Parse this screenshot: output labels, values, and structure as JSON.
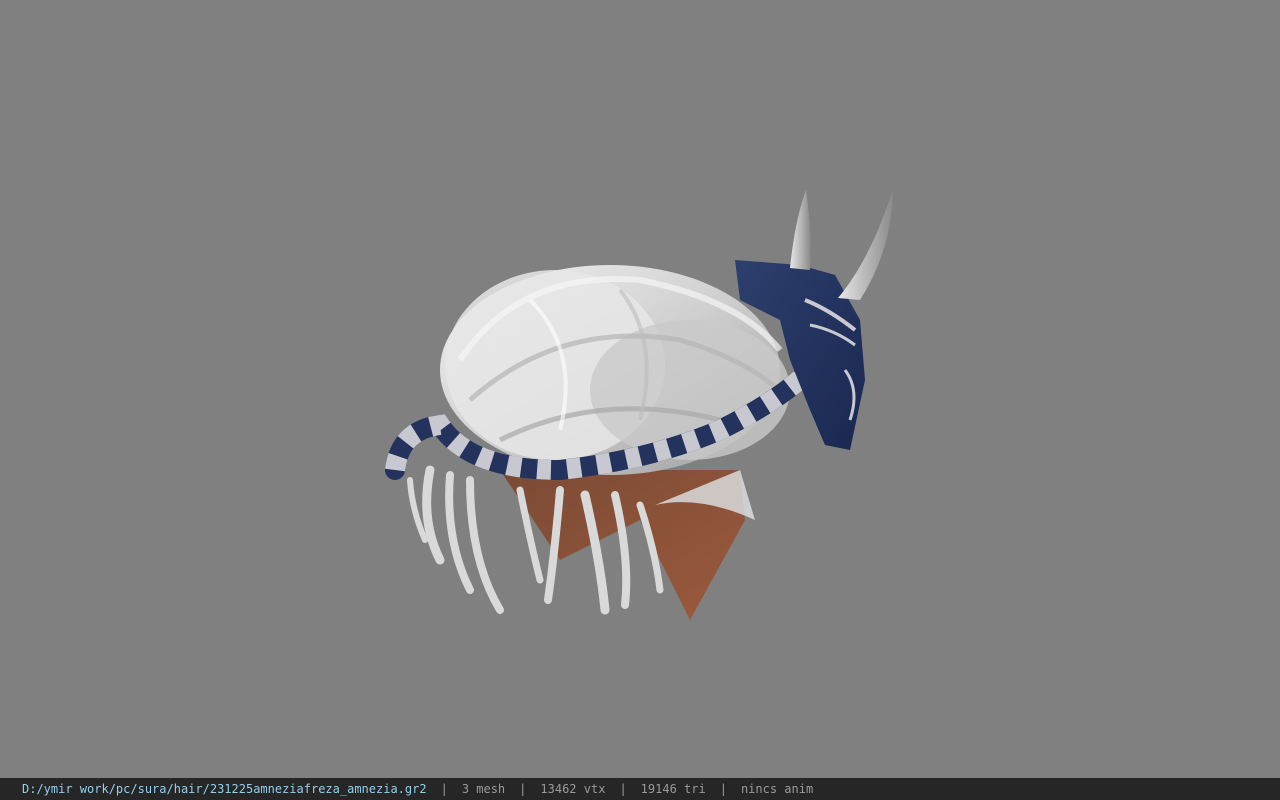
{
  "viewer": {
    "background_color": "#808080",
    "model_description": "hair model with mask and horns"
  },
  "status_bar": {
    "file_path": "D:/ymir work/pc/sura/hair/231225amneziafreza_amnezia.gr2",
    "mesh_count": "3 mesh",
    "vertex_count": "13462 vtx",
    "triangle_count": "19146 tri",
    "animation": "nincs anim",
    "separator": "|",
    "path_color": "#8fd0ee",
    "text_color": "#9a9a9a",
    "bar_color": "#262626"
  }
}
